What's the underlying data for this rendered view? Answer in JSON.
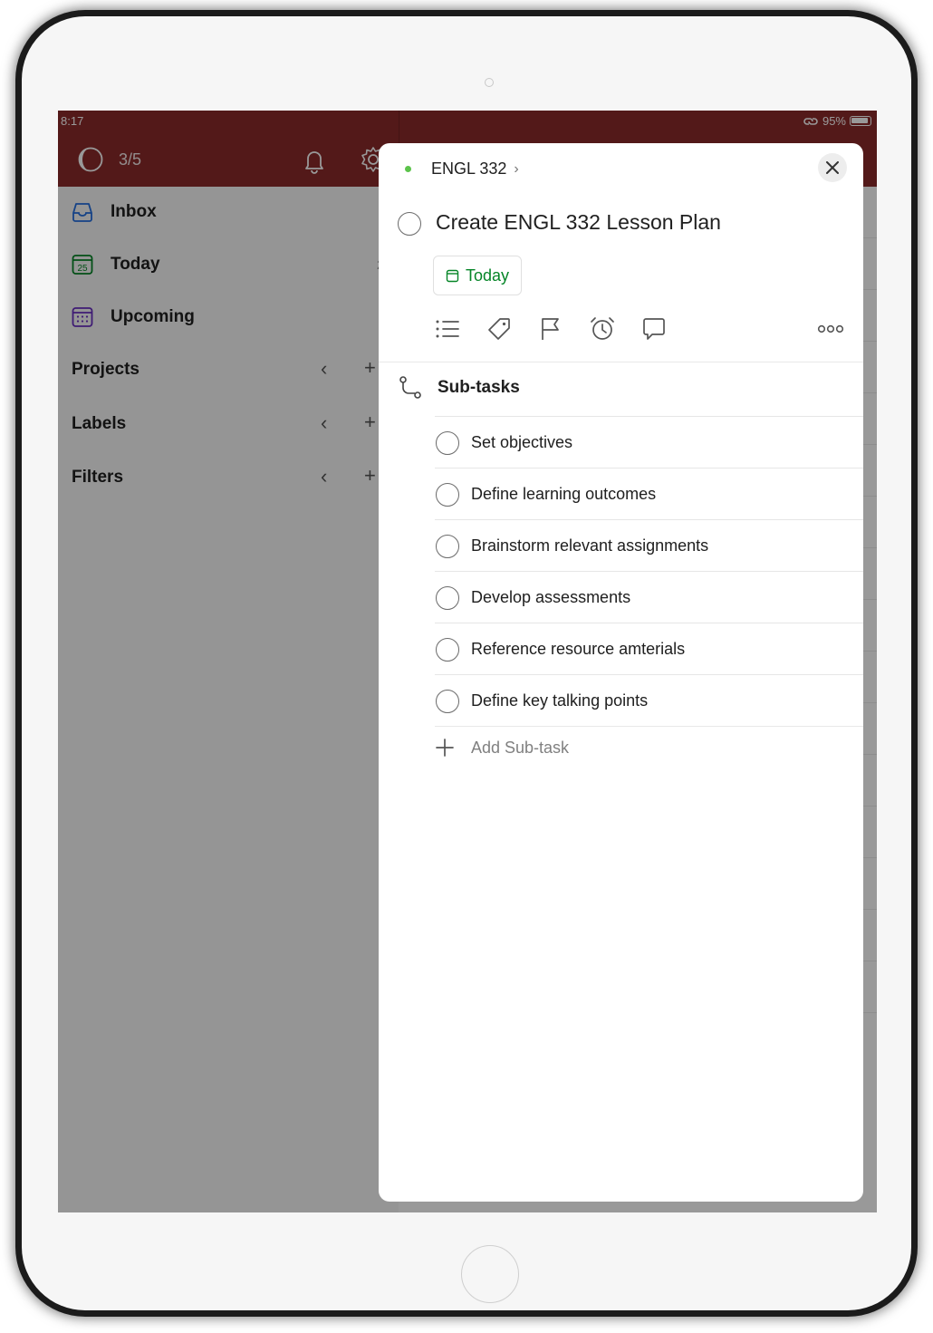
{
  "status_bar": {
    "time": "8:17",
    "battery": "95%"
  },
  "header": {
    "productivity_count": "3/5"
  },
  "sidebar": {
    "items": [
      {
        "label": "Inbox",
        "count": ""
      },
      {
        "label": "Today",
        "count": "2"
      },
      {
        "label": "Upcoming",
        "count": ""
      }
    ],
    "sections": [
      {
        "label": "Projects"
      },
      {
        "label": "Labels"
      },
      {
        "label": "Filters"
      }
    ]
  },
  "task": {
    "project": "ENGL 332",
    "title": "Create ENGL 332 Lesson Plan",
    "due": "Today"
  },
  "subtasks": {
    "header": "Sub-tasks",
    "items": [
      "Set objectives",
      "Define learning outcomes",
      "Brainstorm relevant assignments",
      "Develop assessments",
      "Reference resource amterials",
      "Define key talking points"
    ],
    "add_label": "Add Sub-task"
  },
  "colors": {
    "brand_red": "#8b2a2a",
    "date_green": "#058527",
    "project_dot": "#5cc34b"
  }
}
